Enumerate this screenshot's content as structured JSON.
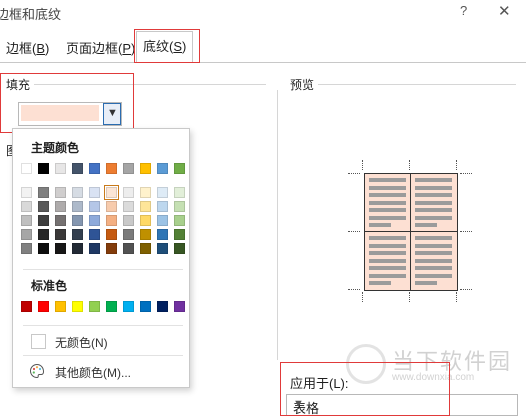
{
  "window": {
    "title": "边框和底纹",
    "help": "?",
    "close": "✕"
  },
  "tabs": [
    {
      "label": "边框",
      "key": "B"
    },
    {
      "label": "页面边框",
      "key": "P"
    },
    {
      "label": "底纹",
      "key": "S"
    }
  ],
  "fill": {
    "label": "填充",
    "current_color": "#fde0d3"
  },
  "pattern_label_partial": "图",
  "palette": {
    "theme_title": "主题颜色",
    "standard_title": "标准色",
    "theme_top": [
      "#ffffff",
      "#000000",
      "#e7e6e6",
      "#44546a",
      "#4472c4",
      "#ed7d31",
      "#a5a5a5",
      "#ffc000",
      "#5b9bd5",
      "#70ad47"
    ],
    "theme_shades": [
      [
        "#f2f2f2",
        "#d9d9d9",
        "#bfbfbf",
        "#a6a6a6",
        "#808080"
      ],
      [
        "#7f7f7f",
        "#595959",
        "#3f3f3f",
        "#262626",
        "#0d0d0d"
      ],
      [
        "#d0cece",
        "#aeabab",
        "#757171",
        "#3a3838",
        "#171616"
      ],
      [
        "#d6dce4",
        "#adb9ca",
        "#8496b0",
        "#333f4f",
        "#222a35"
      ],
      [
        "#d9e2f3",
        "#b4c6e7",
        "#8eaadb",
        "#2f5496",
        "#1f3864"
      ],
      [
        "#fbe5d5",
        "#f7cbac",
        "#f4b083",
        "#c55a11",
        "#833c0b"
      ],
      [
        "#ededed",
        "#dbdbdb",
        "#c9c9c9",
        "#7b7b7b",
        "#525252"
      ],
      [
        "#fff2cc",
        "#fee599",
        "#ffd965",
        "#bf9000",
        "#7f6000"
      ],
      [
        "#deebf6",
        "#bdd7ee",
        "#9cc3e5",
        "#2e75b5",
        "#1e4e79"
      ],
      [
        "#e2efd9",
        "#c5e0b3",
        "#a8d08d",
        "#538135",
        "#375623"
      ]
    ],
    "selected": {
      "col": 5,
      "row": 0
    },
    "standard": [
      "#c00000",
      "#ff0000",
      "#ffc000",
      "#ffff00",
      "#92d050",
      "#00b050",
      "#00b0f0",
      "#0070c0",
      "#002060",
      "#7030a0"
    ],
    "no_color": "无颜色(N)",
    "more_colors": "其他颜色(M)..."
  },
  "preview": {
    "label": "预览"
  },
  "apply_to": {
    "label": "应用于(L):",
    "value": "表格"
  },
  "watermark": {
    "text": "当下软件园",
    "url": "www.downxia.com"
  }
}
